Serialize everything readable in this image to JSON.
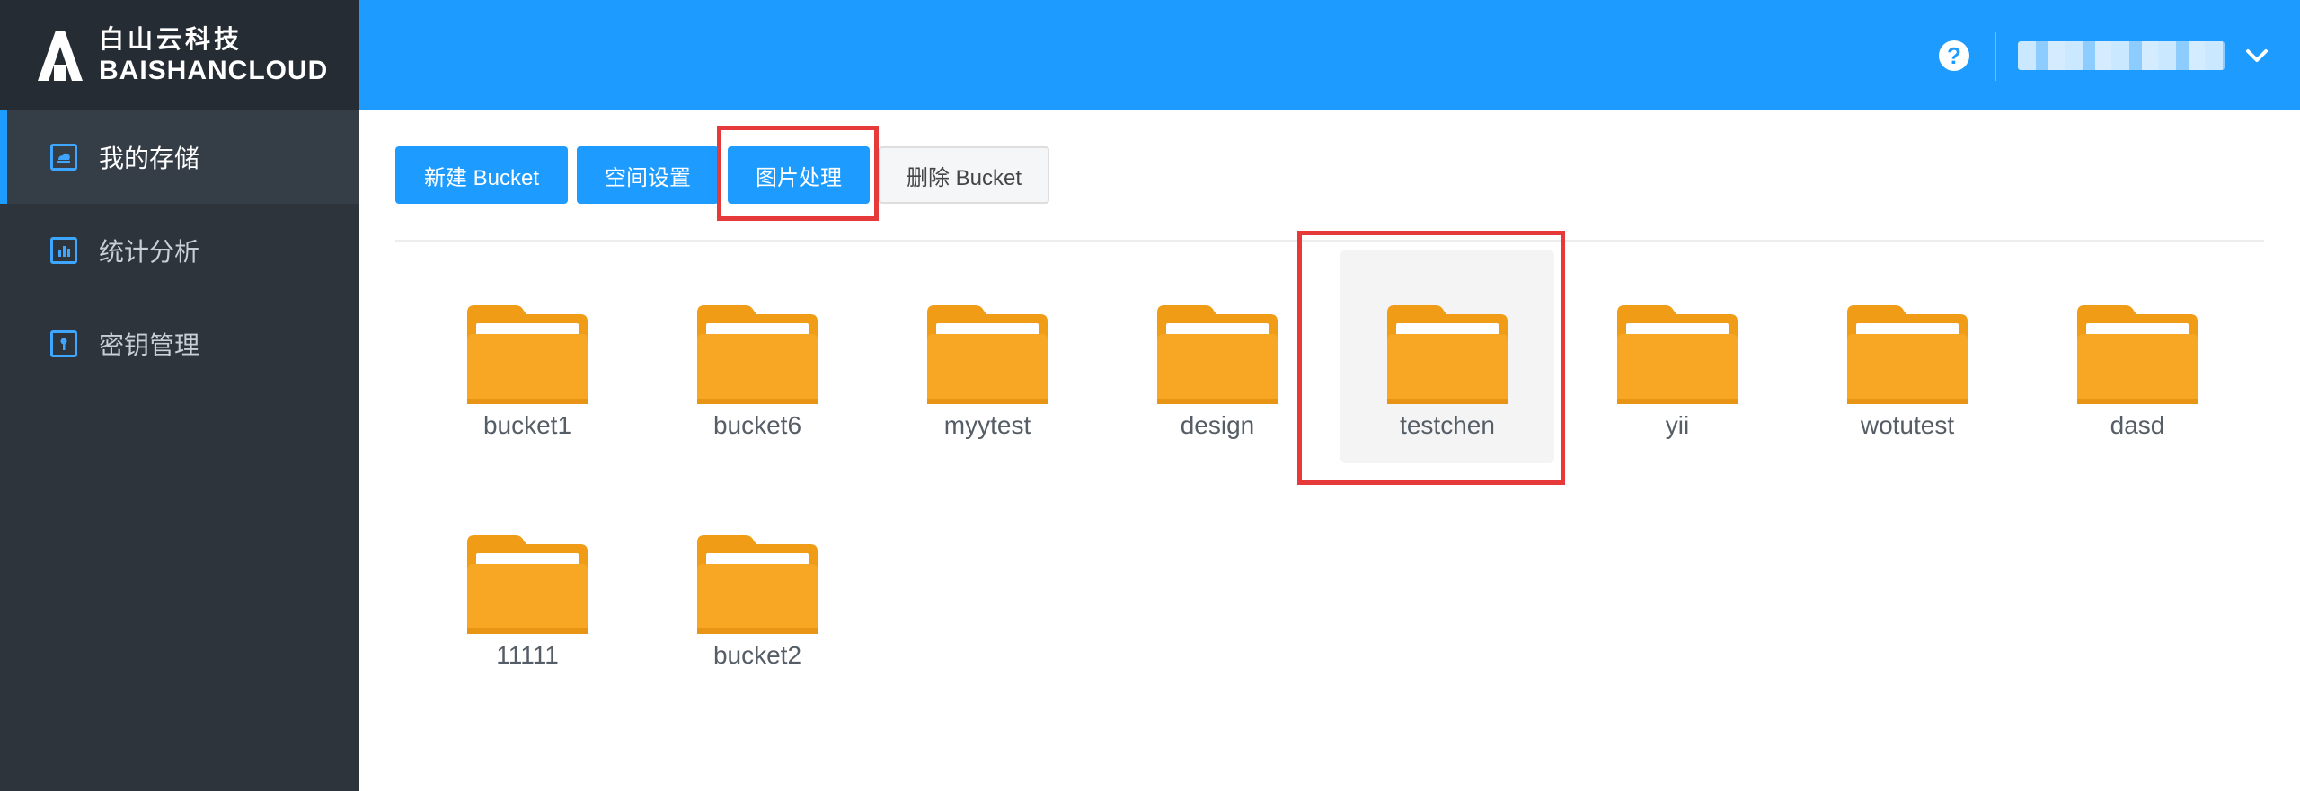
{
  "brand": {
    "cn": "白山云科技",
    "en": "BAISHANCLOUD"
  },
  "sidebar": {
    "items": [
      {
        "label": "我的存储",
        "icon": "cloud-storage-icon",
        "active": true
      },
      {
        "label": "统计分析",
        "icon": "bar-chart-icon",
        "active": false
      },
      {
        "label": "密钥管理",
        "icon": "key-icon",
        "active": false
      }
    ]
  },
  "header": {
    "help_label": "?",
    "username": ""
  },
  "toolbar": {
    "new_bucket": "新建 Bucket",
    "space_settings": "空间设置",
    "image_processing": "图片处理",
    "delete_bucket": "删除 Bucket"
  },
  "buckets": [
    {
      "name": "bucket1"
    },
    {
      "name": "bucket6"
    },
    {
      "name": "myytest"
    },
    {
      "name": "design"
    },
    {
      "name": "testchen",
      "selected": true
    },
    {
      "name": "yii"
    },
    {
      "name": "wotutest"
    },
    {
      "name": "dasd"
    },
    {
      "name": "11111"
    },
    {
      "name": "bucket2"
    }
  ],
  "colors": {
    "primary": "#1e9bff",
    "sidebar": "#2d343c",
    "folder": "#f7a723",
    "highlight": "#e63a3a"
  }
}
